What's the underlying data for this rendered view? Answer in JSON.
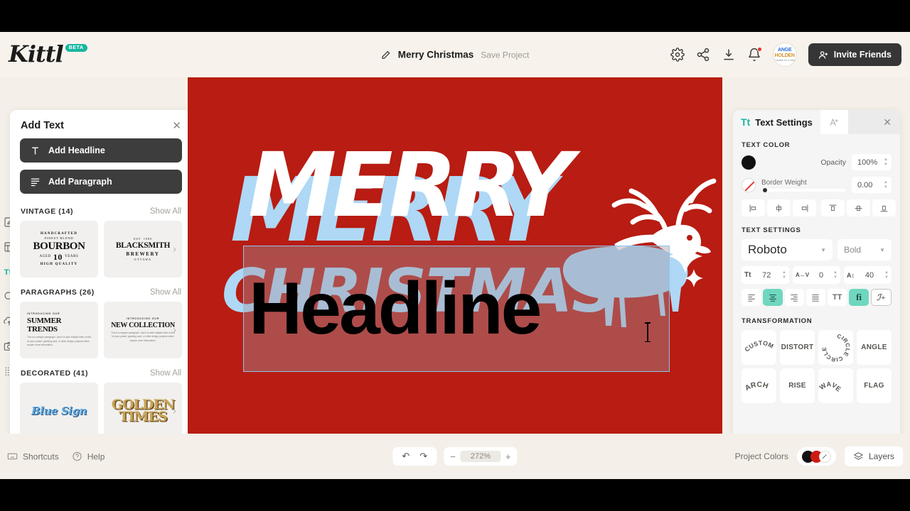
{
  "brand": {
    "name": "Kittl",
    "badge": "BETA"
  },
  "header": {
    "doc_title": "Merry Christmas",
    "save_label": "Save Project",
    "invite_label": "Invite Friends",
    "avatar": {
      "line1": "ANGE",
      "line2": "HOLDEN",
      "line3": "Creative for a New"
    },
    "icons": [
      "gear-icon",
      "share-icon",
      "download-icon",
      "notification-bell-icon"
    ]
  },
  "left_panel": {
    "title": "Add Text",
    "add_headline": "Add Headline",
    "add_paragraph": "Add Paragraph",
    "sections": [
      {
        "title": "VINTAGE (14)",
        "show_all": "Show All",
        "cards": [
          {
            "arc_top": "HANDCRAFTED",
            "sub": "FINEST BLEND",
            "main": "BOURBON",
            "left": "AGED",
            "num": "10",
            "right": "YEARS",
            "arc_bottom": "HIGH QUALITY"
          },
          {
            "est": "EST. 1989",
            "main": "BLACKSMITH",
            "mid": "BREWERY",
            "sub": "OTTAWA"
          }
        ]
      },
      {
        "title": "PARAGRAPHS (26)",
        "show_all": "Show All",
        "cards": [
          {
            "kicker": "INTRODUCING OUR",
            "title": "SUMMER TRENDS",
            "body": "This is a sample paragraph. Use it to add multiple lines of text for your poster, greeting card, or other design projects which require more information."
          },
          {
            "kicker": "INTRODUCING OUR",
            "title": "NEW COLLECTION",
            "body": "This is a sample paragraph. Use it to add multiple lines of text for your poster, greeting card, or other design projects which require more information."
          }
        ]
      },
      {
        "title": "DECORATED (41)",
        "show_all": "Show All",
        "cards": [
          {
            "title": "Blue Sign"
          },
          {
            "line1": "GOLDEN",
            "line2": "TIMES"
          }
        ]
      }
    ]
  },
  "rail_icons": [
    "edit-icon",
    "templates-icon",
    "text-icon",
    "shapes-icon",
    "upload-icon",
    "photo-icon",
    "grid-icon"
  ],
  "canvas": {
    "background_color": "#b81c12",
    "art_line1": "MERRY",
    "art_line2": "CHRISTMAS",
    "art_color": "#ffffff",
    "art_shadow_color": "#aed8f5",
    "selected_text": "Headline",
    "selected_text_color": "#000000"
  },
  "right_panel": {
    "tab_active": "Text Settings",
    "tab_active_icon": "Tt",
    "tab_inactive_icon": "effects-icon",
    "text_color_label": "TEXT COLOR",
    "text_color": "#111111",
    "opacity_label": "Opacity",
    "opacity_value": "100%",
    "border_weight_label": "Border Weight",
    "border_weight_value": "0.00",
    "align_icons": [
      "align-left-icon",
      "align-center-icon",
      "align-right-icon",
      "align-top-icon",
      "align-middle-icon",
      "align-bottom-icon"
    ],
    "text_settings_label": "TEXT SETTINGS",
    "font_family": "Roboto",
    "font_weight": "Bold",
    "font_size": "72",
    "letter_spacing": "0",
    "line_height": "40",
    "format_buttons": [
      {
        "icon": "text-align-left-icon",
        "label": "",
        "active": false
      },
      {
        "icon": "text-align-center-icon",
        "label": "",
        "active": true
      },
      {
        "icon": "text-align-right-icon",
        "label": "",
        "active": false
      },
      {
        "icon": "text-align-justify-icon",
        "label": "",
        "active": false
      },
      {
        "icon": "uppercase-icon",
        "label": "TT",
        "active": false
      },
      {
        "icon": "ligature-icon",
        "label": "fi",
        "active": true
      },
      {
        "icon": "add-font-icon",
        "label": "ℐ+",
        "active": false
      }
    ],
    "transformation_label": "TRANSFORMATION",
    "transformations": [
      "CUSTOM",
      "DISTORT",
      "CIRCLE",
      "ANGLE",
      "ARCH",
      "RISE",
      "WAVE",
      "FLAG"
    ]
  },
  "footer": {
    "shortcuts": "Shortcuts",
    "help": "Help",
    "zoom_value": "272%",
    "project_colors": "Project Colors",
    "project_color_swatches": [
      "#111111",
      "#cf1a10",
      "#ffffff"
    ],
    "layers": "Layers"
  }
}
